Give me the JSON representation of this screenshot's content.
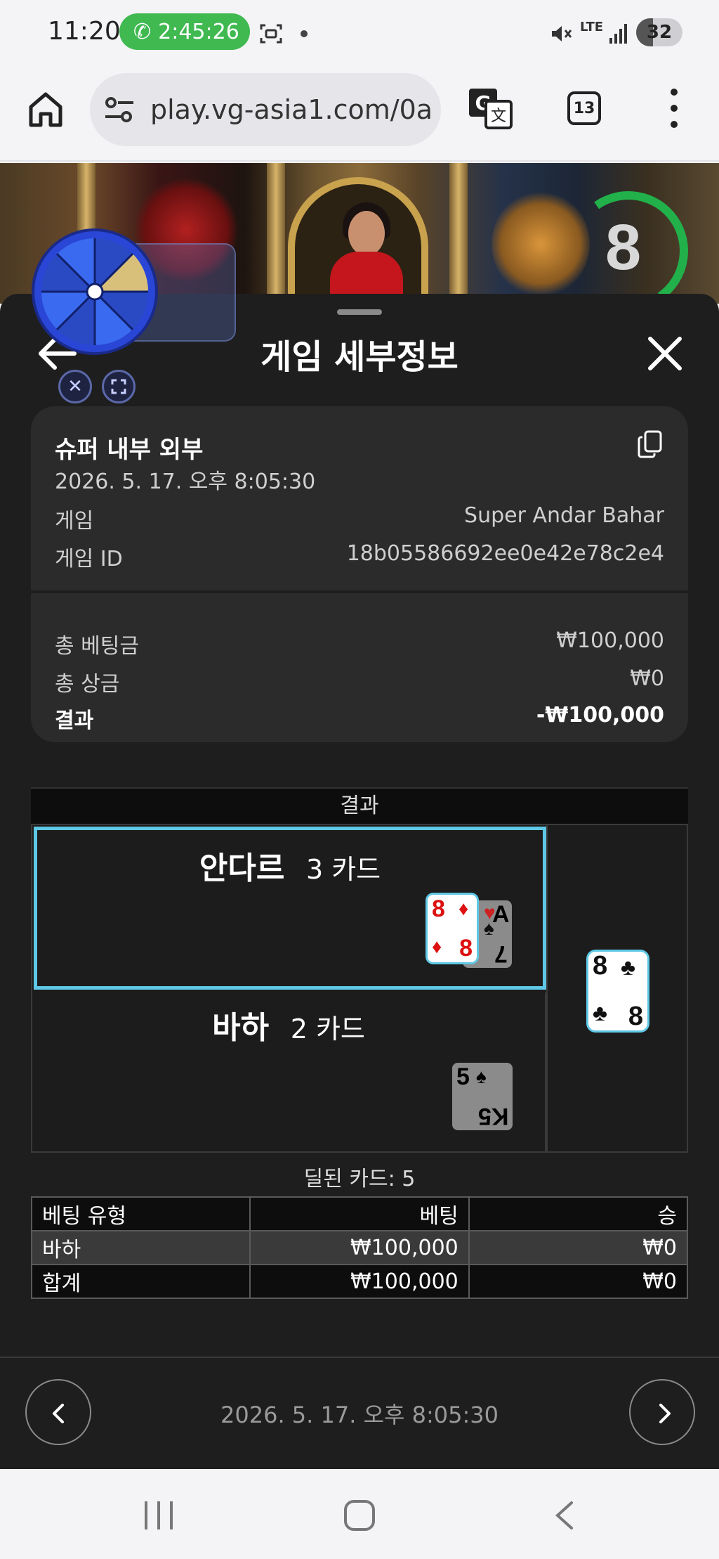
{
  "status_bar": {
    "time": "11:20",
    "call_timer": "2:45:26",
    "network": "LTE",
    "battery": "32"
  },
  "browser": {
    "url": "play.vg-asia1.com/0a",
    "tab_count": "13"
  },
  "game": {
    "timer_value": "8"
  },
  "modal": {
    "title": "게임 세부정보",
    "summary": {
      "game_name": "슈퍼 내부 외부",
      "datetime": "2026. 5. 17. 오후 8:05:30",
      "rows": [
        {
          "label": "게임",
          "value": "Super Andar Bahar"
        },
        {
          "label": "게임 ID",
          "value": "18b05586692ee0e42e78c2e4"
        }
      ],
      "totals": [
        {
          "label": "총 베팅금",
          "value": "₩100,000"
        },
        {
          "label": "총 상금",
          "value": "₩0"
        }
      ],
      "result_label": "결과",
      "result_value": "-₩100,000"
    },
    "results_header": "결과",
    "andar": {
      "name": "안다르",
      "count": "3 카드"
    },
    "bahar": {
      "name": "바하",
      "count": "2 카드"
    },
    "cards": {
      "andar_front_rank": "8",
      "andar_front_suit": "♦",
      "andar_back_rank": "A",
      "andar_back2_rank": "7",
      "andar_back_suit": "♥",
      "andar_back2_suit": "♠",
      "bahar_rank_top": "5",
      "bahar_rank_bottom": "K5",
      "bahar_suit": "♠",
      "joker_rank": "8",
      "joker_suit": "♣"
    },
    "dealt_cards": "딜된 카드: 5",
    "bet_table": {
      "headers": [
        "베팅 유형",
        "베팅",
        "승"
      ],
      "rows": [
        [
          "바하",
          "₩100,000",
          "₩0"
        ],
        [
          "합계",
          "₩100,000",
          "₩0"
        ]
      ]
    },
    "footer_date": "2026. 5. 17. 오후 8:05:30"
  },
  "colors": {
    "highlight_border": "#5ec8e6",
    "call_pill": "#3fb950",
    "modal_bg": "#1e1e1f"
  }
}
